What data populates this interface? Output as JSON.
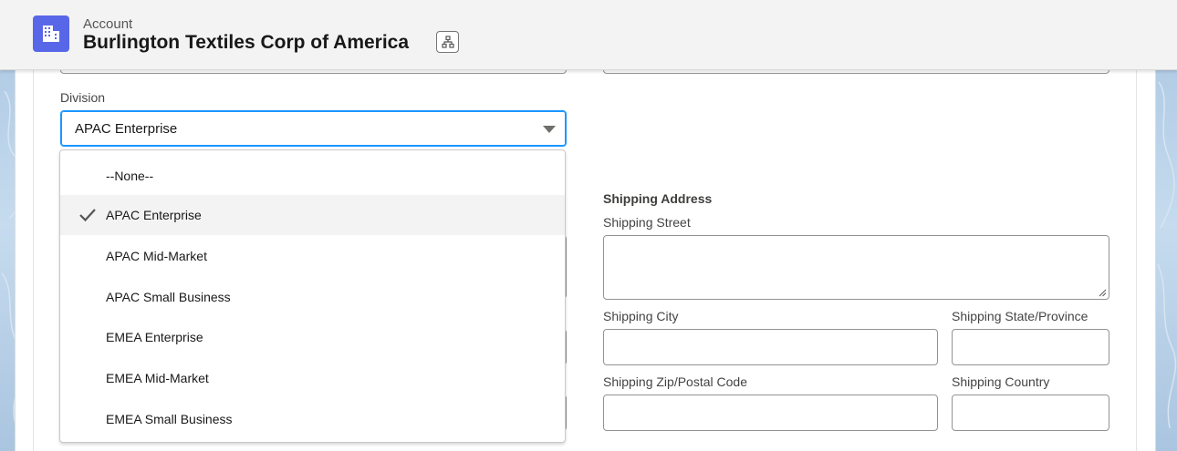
{
  "header": {
    "object_label": "Account",
    "record_title": "Burlington Textiles Corp of America",
    "app_icon": "building-icon",
    "hierarchy_icon": "hierarchy-icon",
    "brand_color": "#5867e8"
  },
  "form": {
    "division": {
      "label": "Division",
      "value": "APAC Enterprise",
      "options": [
        {
          "label": "--None--",
          "selected": false
        },
        {
          "label": "APAC Enterprise",
          "selected": true
        },
        {
          "label": "APAC Mid-Market",
          "selected": false
        },
        {
          "label": "APAC Small Business",
          "selected": false
        },
        {
          "label": "EMEA Enterprise",
          "selected": false
        },
        {
          "label": "EMEA Mid-Market",
          "selected": false
        },
        {
          "label": "EMEA Small Business",
          "selected": false
        }
      ]
    },
    "shipping": {
      "section_title": "Shipping Address",
      "street_label": "Shipping Street",
      "street_value": "",
      "city_label": "Shipping City",
      "city_value": "",
      "state_label": "Shipping State/Province",
      "state_value": "",
      "zip_label": "Shipping Zip/Postal Code",
      "zip_value": "",
      "country_label": "Shipping Country",
      "country_value": ""
    }
  },
  "colors": {
    "focus_border": "#1b96ff",
    "selected_option_bg": "#f3f3f3"
  }
}
